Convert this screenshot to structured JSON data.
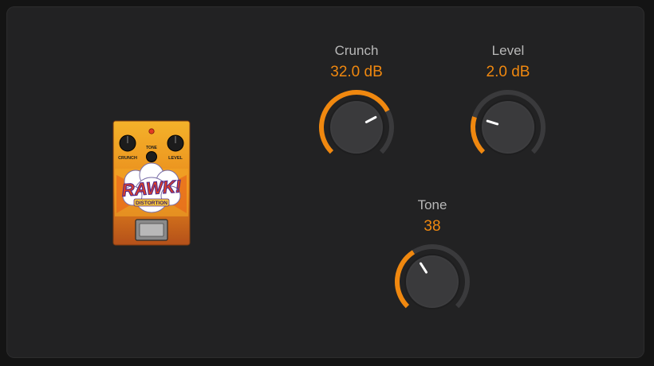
{
  "pedal": {
    "brand_text": "RAWK!",
    "model_text": "DISTORTION",
    "knob_labels": {
      "crunch": "CRUNCH",
      "tone": "TONE",
      "level": "LEVEL"
    }
  },
  "controls": {
    "crunch": {
      "label": "Crunch",
      "value_text": "32.0 dB",
      "position": 0.73
    },
    "level": {
      "label": "Level",
      "value_text": "2.0 dB",
      "position": 0.23
    },
    "tone": {
      "label": "Tone",
      "value_text": "38",
      "position": 0.38
    }
  },
  "colors": {
    "accent": "#f0880f",
    "track": "#3a3a3c",
    "background": "#222223",
    "label": "#b8b8b8"
  }
}
